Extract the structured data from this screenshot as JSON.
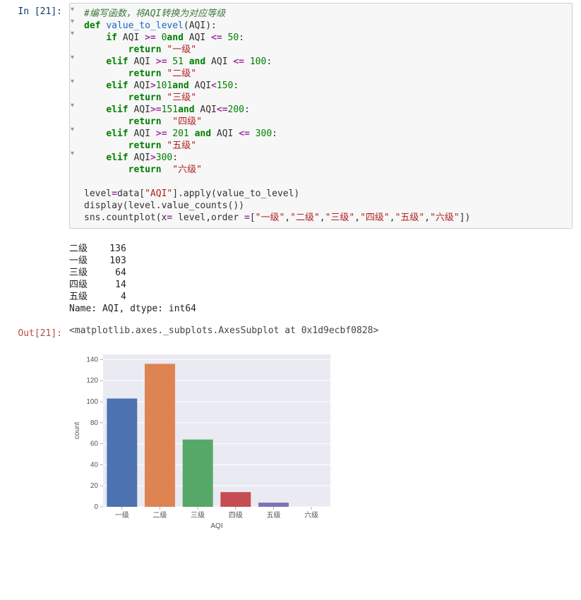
{
  "in_prompt": "In [21]:",
  "out_prompt": "Out[21]:",
  "code_comment": "#编写函数，将AQI转换为对应等级",
  "code_lines": {
    "def": "def value_to_level(AQI):",
    "if1": "    if AQI >= 0and AQI <= 50:",
    "ret1": "        return \"一级\"",
    "elif2": "    elif AQI >= 51 and AQI <= 100:",
    "ret2": "        return \"二级\"",
    "elif3": "    elif AQI>101and AQI<150:",
    "ret3": "        return \"三级\"",
    "elif4": "    elif AQI>=151and AQI<=200:",
    "ret4": "        return  \"四级\"",
    "elif5": "    elif AQI >= 201 and AQI <= 300:",
    "ret5": "        return \"五级\"",
    "elif6": "    elif AQI>300:",
    "ret6": "        return  \"六级\"",
    "blank": "",
    "l_apply": "level=data[\"AQI\"].apply(value_to_level)",
    "l_disp": "display(level.value_counts())",
    "l_sns": "sns.countplot(x= level,order =[\"一级\",\"二级\",\"三级\",\"四级\",\"五级\",\"六级\"])"
  },
  "value_counts_output": "二级    136\n一级    103\n三级     64\n四级     14\n五级      4\nName: AQI, dtype: int64",
  "repr_output": "<matplotlib.axes._subplots.AxesSubplot at 0x1d9ecbf0828>",
  "chart_data": {
    "type": "bar",
    "title": "",
    "xlabel": "AQI",
    "ylabel": "count",
    "categories": [
      "一级",
      "二级",
      "三级",
      "四级",
      "五级",
      "六级"
    ],
    "values": [
      103,
      136,
      64,
      14,
      4,
      0
    ],
    "colors": [
      "#4c72b0",
      "#dd8452",
      "#55a868",
      "#c44e52",
      "#8172b3",
      "#937860"
    ],
    "yticks": [
      0,
      20,
      40,
      60,
      80,
      100,
      120,
      140
    ],
    "ylim": [
      0,
      145
    ]
  }
}
